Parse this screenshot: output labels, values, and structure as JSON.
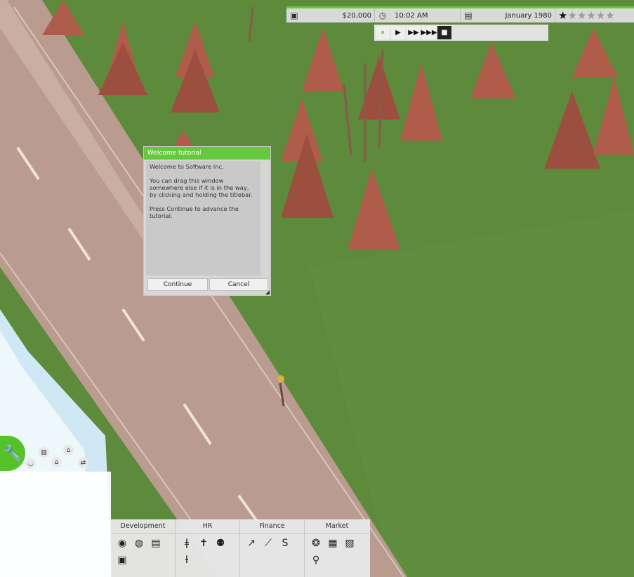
{
  "topbar": {
    "money": "$20,000",
    "time": "10:02 AM",
    "date": "January 1980",
    "rating_stars_filled": 1,
    "rating_stars_total": 6,
    "icons": [
      "wallet-icon",
      "clock-icon",
      "calendar-icon",
      "star-icon"
    ]
  },
  "speed": {
    "buttons": [
      "pause",
      "play",
      "fast-forward",
      "fastest-forward",
      "stop"
    ],
    "active": "pause",
    "accent": "#56c22a"
  },
  "tutorial": {
    "title": "Welcome tutorial",
    "body": "Welcome to Software Inc.\n\nYou can drag this window somewhere else if it is in the way, by clicking and holding the titlebar.\n\nPress Continue to advance the tutorial.",
    "continue_label": "Continue",
    "cancel_label": "Cancel"
  },
  "toolbar": {
    "categories": [
      {
        "label": "Development",
        "icons": [
          "browse-projects-icon",
          "globe-icon",
          "document-icon",
          "screen-icon"
        ]
      },
      {
        "label": "HR",
        "icons": [
          "employee-icon",
          "hire-icon",
          "team-icon",
          "staff-icon"
        ]
      },
      {
        "label": "Finance",
        "icons": [
          "trend-arrow-icon",
          "chart-icon",
          "dollar-icon"
        ]
      },
      {
        "label": "Market",
        "icons": [
          "market-globe-icon",
          "grid-icon",
          "news-icon",
          "download-icon"
        ]
      }
    ]
  },
  "colors": {
    "accent_green": "#66c93d",
    "grass": "#5e8a3c",
    "road": "#b89a8e",
    "trees": "#b05c4a"
  }
}
